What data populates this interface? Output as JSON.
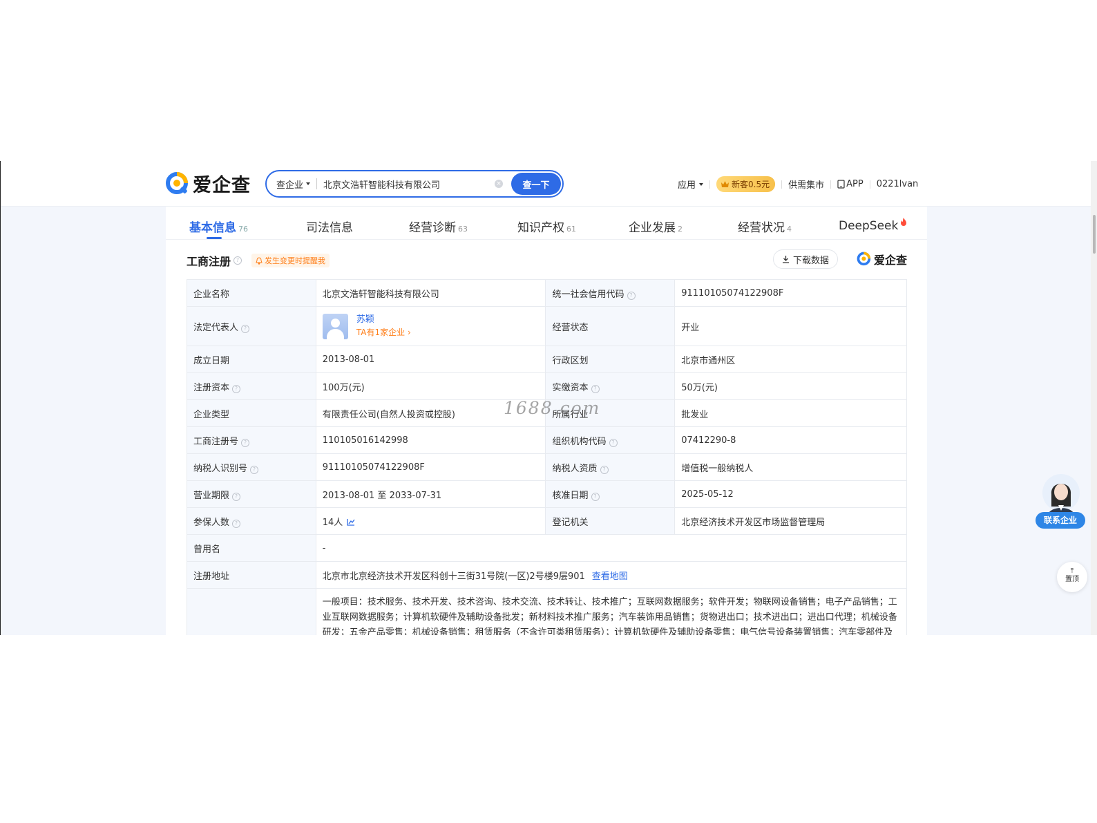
{
  "header": {
    "logo_text": "爱企查",
    "search_type": "查企业",
    "search_value": "北京文浩轩智能科技有限公司",
    "search_button": "查一下",
    "nav": {
      "apps": "应用",
      "vip": "新客0.5元",
      "market": "供需集市",
      "app": "APP",
      "user": "0221lvan"
    }
  },
  "tabs": [
    {
      "label": "基本信息",
      "count": "76"
    },
    {
      "label": "司法信息",
      "count": ""
    },
    {
      "label": "经营诊断",
      "count": "63"
    },
    {
      "label": "知识产权",
      "count": "61"
    },
    {
      "label": "企业发展",
      "count": "2"
    },
    {
      "label": "经营状况",
      "count": "4"
    },
    {
      "label": "DeepSeek",
      "count": ""
    }
  ],
  "section": {
    "title": "工商注册",
    "remind": "发生变更时提醒我",
    "download": "下载数据",
    "brand": "爱企查"
  },
  "info": {
    "company_name_label": "企业名称",
    "company_name": "北京文浩轩智能科技有限公司",
    "credit_code_label": "统一社会信用代码",
    "credit_code": "91110105074122908F",
    "legal_rep_label": "法定代表人",
    "legal_rep_name": "苏颖",
    "legal_rep_sub": "TA有1家企业 ›",
    "status_label": "经营状态",
    "status": "开业",
    "founded_label": "成立日期",
    "founded": "2013-08-01",
    "region_label": "行政区划",
    "region": "北京市通州区",
    "reg_capital_label": "注册资本",
    "reg_capital": "100万(元)",
    "paid_capital_label": "实缴资本",
    "paid_capital": "50万(元)",
    "type_label": "企业类型",
    "type": "有限责任公司(自然人投资或控股)",
    "industry_label": "所属行业",
    "industry": "批发业",
    "reg_no_label": "工商注册号",
    "reg_no": "110105016142998",
    "org_code_label": "组织机构代码",
    "org_code": "07412290-8",
    "taxpayer_id_label": "纳税人识别号",
    "taxpayer_id": "91110105074122908F",
    "taxpayer_qual_label": "纳税人资质",
    "taxpayer_qual": "增值税一般纳税人",
    "term_label": "营业期限",
    "term": "2013-08-01 至 2033-07-31",
    "approved_label": "核准日期",
    "approved": "2025-05-12",
    "insured_label": "参保人数",
    "insured": "14人",
    "authority_label": "登记机关",
    "authority": "北京经济技术开发区市场监督管理局",
    "former_name_label": "曾用名",
    "former_name": "-",
    "address_label": "注册地址",
    "address": "北京市北京经济技术开发区科创十三街31号院(一区)2号楼9层901",
    "map_link": "查看地图",
    "scope": "一般项目：技术服务、技术开发、技术咨询、技术交流、技术转让、技术推广；互联网数据服务；软件开发；物联网设备销售；电子产品销售；工业互联网数据服务；计算机软硬件及辅助设备批发；新材料技术推广服务；汽车装饰用品销售；货物进出口；技术进出口；进出口代理；机械设备研发；五金产品零售；机械设备销售；租赁服务（不含许可类租赁服务）；计算机软硬件及辅助设备零售；电气信号设备装置销售；汽车零部件及"
  },
  "watermark": "1688.com",
  "floating": {
    "contact": "联系企业",
    "top_line1": "⤒",
    "top_line2": "置顶"
  },
  "colors": {
    "accent": "#2e6be6",
    "orange": "#ff7f1a",
    "label_bg": "#f5f8fd"
  }
}
